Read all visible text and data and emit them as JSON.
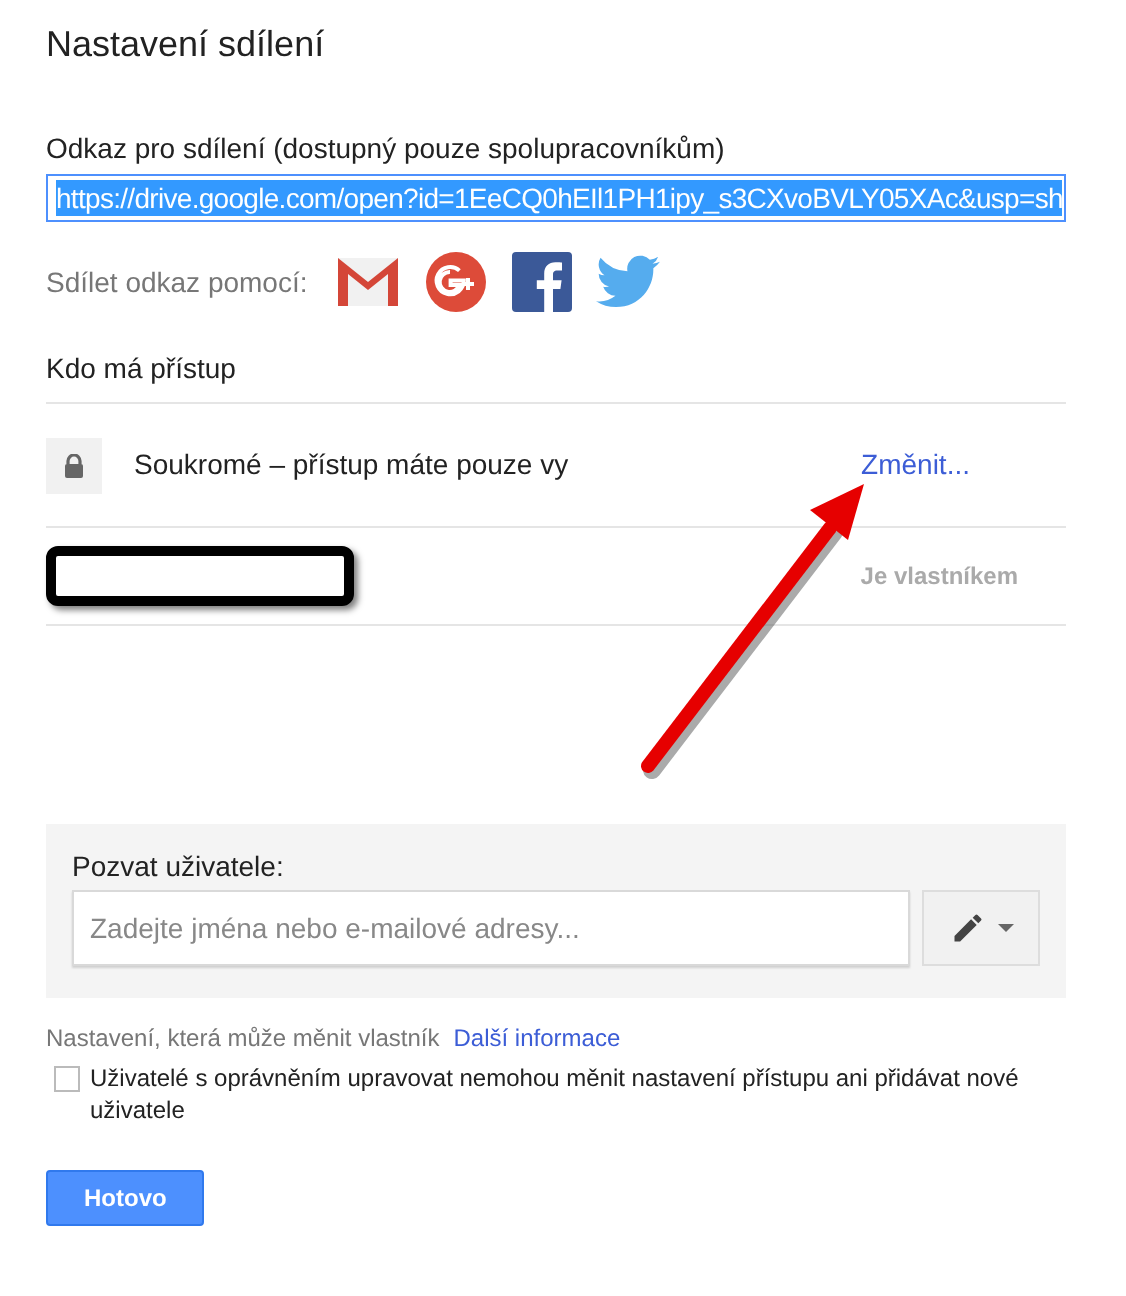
{
  "dialog": {
    "title": "Nastavení sdílení"
  },
  "link": {
    "label": "Odkaz pro sdílení (dostupný pouze spolupracovníkům)",
    "value": "https://drive.google.com/open?id=1EeCQ0hEIl1PH1ipy_s3CXvoBVLY05XAc&usp=sh",
    "selected": true
  },
  "share_via": {
    "label": "Sdílet odkaz pomocí:",
    "services": [
      {
        "kind": "gmail"
      },
      {
        "kind": "gplus"
      },
      {
        "kind": "facebook"
      },
      {
        "kind": "twitter"
      }
    ]
  },
  "access": {
    "heading": "Kdo má přístup",
    "rows": [
      {
        "kind": "visibility",
        "text": "Soukromé – přístup máte pouze vy",
        "action": "Změnit..."
      },
      {
        "kind": "owner",
        "redacted": true,
        "role": "Je vlastníkem"
      }
    ]
  },
  "invite": {
    "label": "Pozvat uživatele:",
    "placeholder": "Zadejte jména nebo e-mailové adresy..."
  },
  "owner_settings": {
    "text": "Nastavení, která může měnit vlastník",
    "link": "Další informace"
  },
  "restrict": {
    "label": "Uživatelé s oprávněním upravovat nemohou měnit nastavení přístupu ani přidávat nové uživatele",
    "checked": false
  },
  "annotation": {
    "kind": "arrow"
  },
  "buttons": [
    {
      "label": "Hotovo"
    }
  ]
}
